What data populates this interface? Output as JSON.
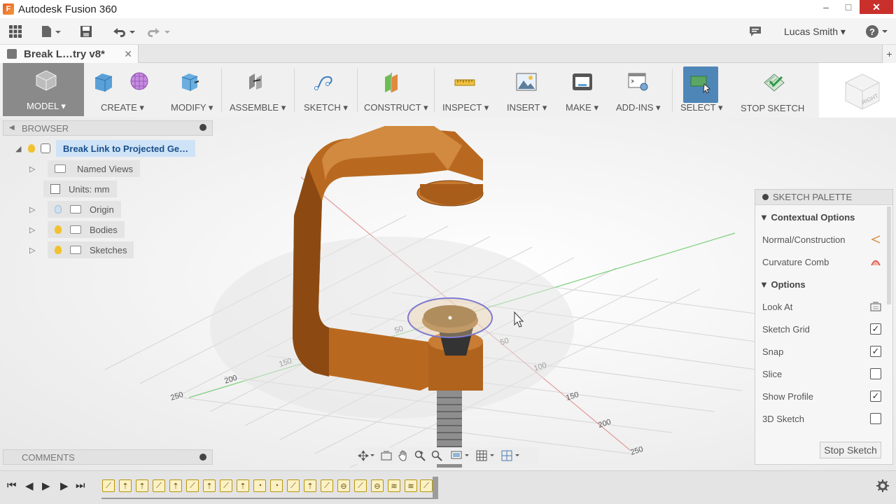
{
  "app": {
    "title": "Autodesk Fusion 360",
    "logo_letter": "F"
  },
  "window_controls": {
    "minimize": "–",
    "maximize": "□",
    "close": "✕"
  },
  "quick_access": {
    "user": "Lucas Smith ▾",
    "help": "?",
    "icons": [
      "grid-icon",
      "file-icon",
      "save-icon",
      "undo-icon",
      "redo-icon",
      "comment-icon",
      "help-icon"
    ]
  },
  "document_tab": {
    "label": "Break L…try v8*",
    "close": "✕",
    "add": "+"
  },
  "ribbon": {
    "workspace": "MODEL ▾",
    "groups": [
      {
        "label": "CREATE ▾"
      },
      {
        "label": "MODIFY ▾"
      },
      {
        "label": "ASSEMBLE ▾"
      },
      {
        "label": "SKETCH ▾"
      },
      {
        "label": "CONSTRUCT ▾"
      },
      {
        "label": "INSPECT ▾"
      },
      {
        "label": "INSERT ▾"
      },
      {
        "label": "MAKE ▾"
      },
      {
        "label": "ADD-INS ▾"
      },
      {
        "label": "SELECT ▾"
      },
      {
        "label": "STOP SKETCH"
      }
    ]
  },
  "viewcube": {
    "face_label": "RIGHT"
  },
  "browser": {
    "header": "BROWSER",
    "root": "Break Link to Projected Ge…",
    "items": [
      {
        "label": "Named Views"
      },
      {
        "label": "Units: mm"
      },
      {
        "label": "Origin"
      },
      {
        "label": "Bodies"
      },
      {
        "label": "Sketches"
      }
    ]
  },
  "comments": {
    "header": "COMMENTS"
  },
  "sketch_palette": {
    "title": "SKETCH PALETTE",
    "contextual_header": "Contextual Options",
    "contextual": [
      {
        "label": "Normal/Construction"
      },
      {
        "label": "Curvature Comb"
      }
    ],
    "options_header": "Options",
    "options": [
      {
        "label": "Look At",
        "type": "button"
      },
      {
        "label": "Sketch Grid",
        "checked": true
      },
      {
        "label": "Snap",
        "checked": true
      },
      {
        "label": "Slice",
        "checked": false
      },
      {
        "label": "Show Profile",
        "checked": true
      },
      {
        "label": "3D Sketch",
        "checked": false
      }
    ],
    "stop_button": "Stop Sketch"
  },
  "grid_labels": [
    "250",
    "200",
    "150",
    "100",
    "50",
    "50",
    "100",
    "150",
    "200",
    "250"
  ],
  "timeline": {
    "controls": [
      "⏮",
      "◀",
      "▶",
      "▶",
      "⏭"
    ]
  }
}
